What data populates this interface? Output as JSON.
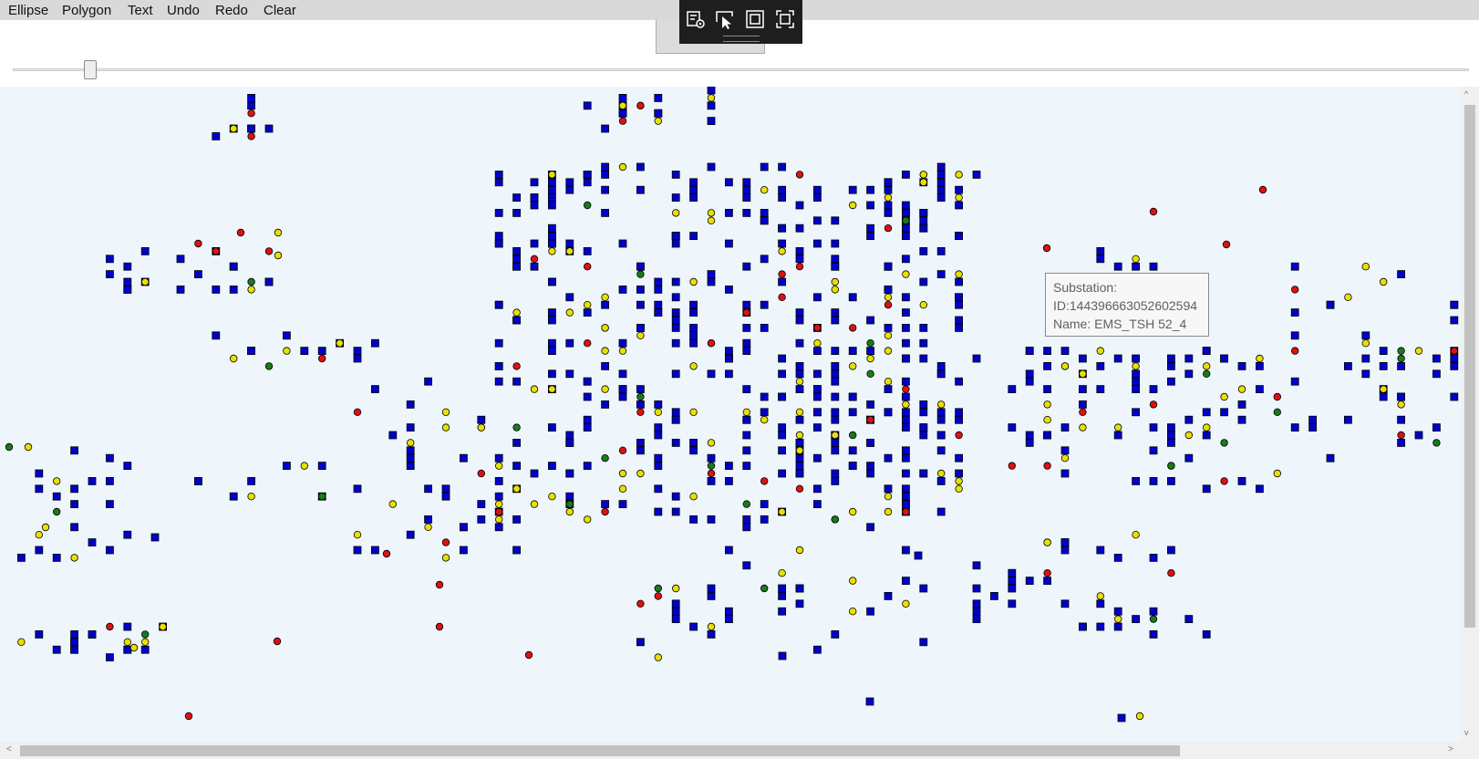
{
  "menu": [
    "Ellipse",
    "Polygon",
    "Text",
    "Undo",
    "Redo",
    "Clear"
  ],
  "toolbar": {
    "icons": [
      "settings-icon",
      "select-pointer-icon",
      "frame-icon",
      "capture-icon"
    ]
  },
  "slider": {
    "value": 0.05
  },
  "tooltip": {
    "line1": "Substation:",
    "line2": "ID:144396663052602594",
    "line3": "Name: EMS_TSH 52_4"
  },
  "scrollbars": {
    "vertical_arrow_up": "^",
    "vertical_arrow_down": "v",
    "horizontal_arrow_left": "<",
    "horizontal_arrow_right": ">"
  },
  "colors": {
    "canvas_bg": "#eef6fc",
    "substation_fill": "#0000cc",
    "switch_closed": "#e8e000",
    "switch_open": "#dd1111",
    "node_green": "#1a7a1a"
  }
}
